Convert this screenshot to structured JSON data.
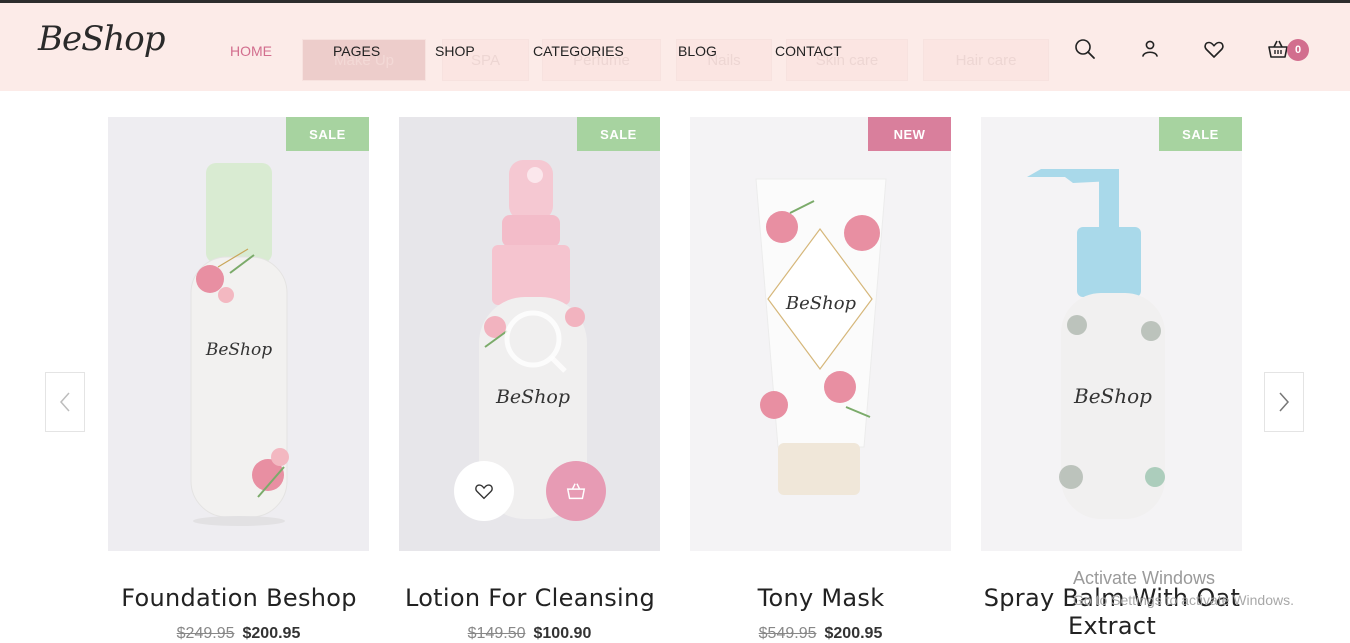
{
  "brand": {
    "logo_text": "BeShop"
  },
  "header": {
    "nav": [
      {
        "label": "HOME",
        "active": true
      },
      {
        "label": "PAGES",
        "active": false
      },
      {
        "label": "SHOP",
        "active": false
      },
      {
        "label": "CATEGORIES",
        "active": false
      },
      {
        "label": "BLOG",
        "active": false
      },
      {
        "label": "CONTACT",
        "active": false
      }
    ],
    "cart_count": "0",
    "icons": [
      "search-icon",
      "user-icon",
      "heart-icon",
      "basket-icon"
    ]
  },
  "filter_tabs": [
    "Make Up",
    "SPA",
    "Perfume",
    "Nails",
    "Skin care",
    "Hair care"
  ],
  "products": [
    {
      "badge": "SALE",
      "badge_type": "sale",
      "title": "Foundation Beshop",
      "old_price": "$249.95",
      "price": "$200.95"
    },
    {
      "badge": "SALE",
      "badge_type": "sale",
      "title": "Lotion For Cleansing",
      "old_price": "$149.50",
      "price": "$100.90"
    },
    {
      "badge": "NEW",
      "badge_type": "new",
      "title": "Tony Mask",
      "old_price": "$549.95",
      "price": "$200.95"
    },
    {
      "badge": "SALE",
      "badge_type": "sale",
      "title": "Spray Balm With Oat Extract",
      "old_price": "",
      "price": ""
    }
  ],
  "watermark": {
    "line1": "Activate Windows",
    "line2": "Go to Settings to activate Windows."
  },
  "colors": {
    "accent": "#d26e8e",
    "header_bg": "#fcebe8",
    "sale": "#a7d3a0",
    "new": "#d97f9c"
  }
}
